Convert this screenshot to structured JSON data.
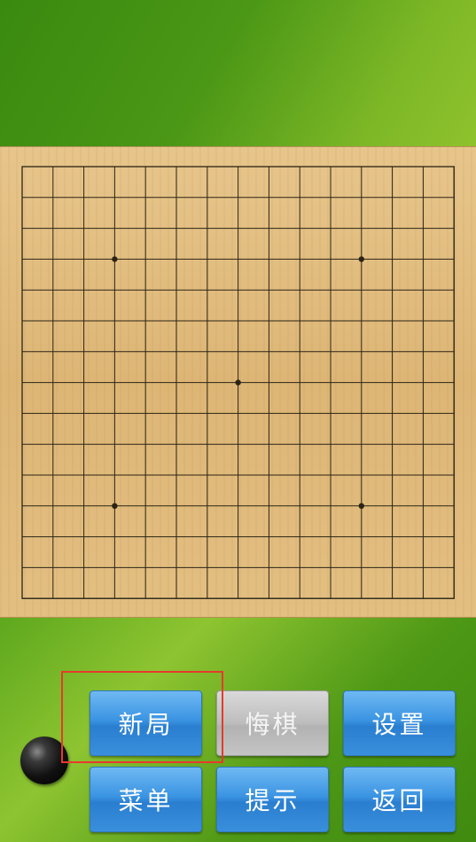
{
  "board": {
    "size": 15,
    "star_points": [
      [
        3,
        3
      ],
      [
        11,
        3
      ],
      [
        7,
        7
      ],
      [
        3,
        11
      ],
      [
        11,
        11
      ]
    ],
    "line_color": "#2b2414"
  },
  "current_player_stone": "black",
  "buttons": {
    "new_game": "新局",
    "undo": "悔棋",
    "settings": "设置",
    "menu": "菜单",
    "hint": "提示",
    "back": "返回"
  },
  "undo_enabled": false,
  "highlighted_button": "new_game",
  "colors": {
    "button_blue": "#3b94e2",
    "button_gray": "#bdbdbd",
    "highlight": "#e63a2c",
    "background_green": "#5aa21a"
  }
}
